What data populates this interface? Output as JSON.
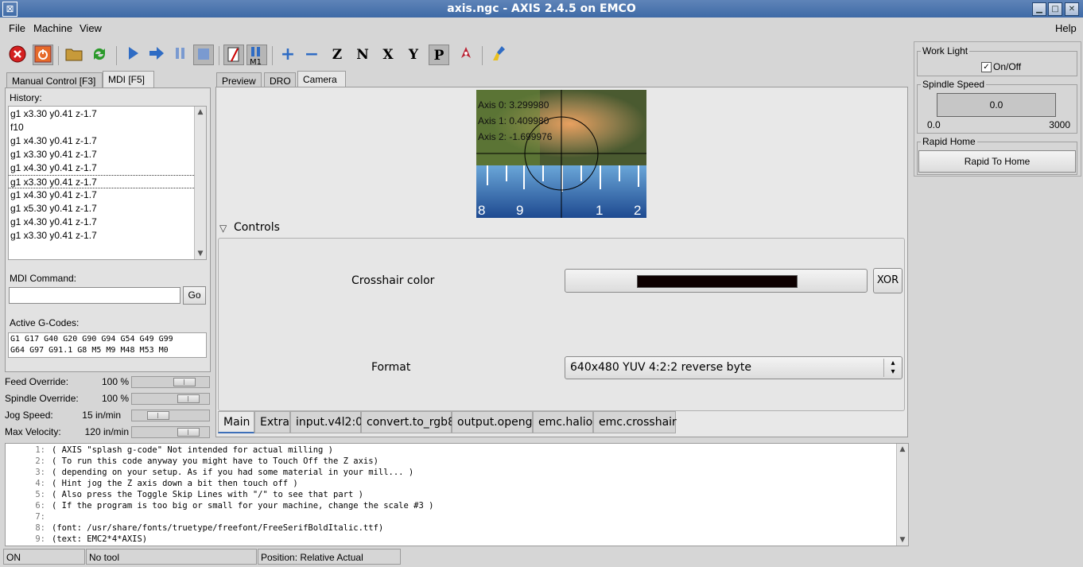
{
  "window": {
    "title": "axis.ngc - AXIS 2.4.5 on EMCO"
  },
  "menu": {
    "file": "File",
    "machine": "Machine",
    "view": "View",
    "help": "Help"
  },
  "toolbar": {
    "icons": [
      "estop-icon",
      "power-icon",
      "open-icon",
      "reload-icon",
      "run-icon",
      "step-icon",
      "pause-icon",
      "stop-icon",
      "block-delete-icon",
      "optional-stop-icon",
      "zoom-in-icon",
      "zoom-out-icon",
      "view-z-icon",
      "view-z2-icon",
      "view-x-icon",
      "view-y-icon",
      "view-p-icon",
      "rotate-icon",
      "clear-plot-icon"
    ],
    "optional_stop_label": "M1"
  },
  "left": {
    "tabs": [
      "Manual Control [F3]",
      "MDI [F5]"
    ],
    "history_label": "History:",
    "history": [
      "g1 x3.30 y0.41 z-1.7",
      "f10",
      "g1 x4.30 y0.41 z-1.7",
      "g1 x3.30 y0.41 z-1.7",
      "g1 x4.30 y0.41 z-1.7",
      "g1 x3.30 y0.41 z-1.7",
      "g1 x4.30 y0.41 z-1.7",
      "g1 x5.30 y0.41 z-1.7",
      "g1 x4.30 y0.41 z-1.7",
      "g1 x3.30 y0.41 z-1.7"
    ],
    "mdi_label": "MDI Command:",
    "mdi_value": "",
    "go_label": "Go",
    "gcodes_label": "Active G-Codes:",
    "gcodes_line1": "G1 G17 G40 G20 G90 G94 G54 G49 G99",
    "gcodes_line2": "G64 G97 G91.1 G8 M5 M9 M48 M53 M0"
  },
  "overrides": {
    "feed_label": "Feed Override:",
    "feed_value": "100 %",
    "feed_level": 0.75,
    "spindle_label": "Spindle Override:",
    "spindle_value": "100 %",
    "spindle_level": 0.82,
    "jog_label": "Jog Speed:",
    "jog_value": "15 in/min",
    "jog_level": 0.27,
    "maxvel_label": "Max Velocity:",
    "maxvel_value": "120 in/min",
    "maxvel_level": 0.82
  },
  "center": {
    "tabs": [
      "Preview",
      "DRO",
      "Camera"
    ],
    "camera_overlay": [
      "Axis 0: 3.299980",
      "Axis 1: 0.409980",
      "Axis 2: -1.699976"
    ],
    "ruler_digits": [
      "8",
      "9",
      "1",
      "2"
    ],
    "controls_label": "Controls",
    "crosshair_label": "Crosshair color",
    "crosshair_color": "#0d0000",
    "xor_label": "XOR",
    "format_label": "Format",
    "format_value": "640x480 YUV 4:2:2 reverse byte",
    "bottom_tabs": [
      "Main",
      "Extra",
      "input.v4l2:0",
      "convert.to_rgb8",
      "output.opengl",
      "emc.halio",
      "emc.crosshair"
    ]
  },
  "right": {
    "work_light_title": "Work Light",
    "work_light_check_label": "On/Off",
    "work_light_checked": true,
    "spindle_title": "Spindle Speed",
    "spindle_value": "0.0",
    "spindle_min": "0.0",
    "spindle_max": "3000",
    "rapid_title": "Rapid Home",
    "rapid_button": "Rapid To Home"
  },
  "code": {
    "lines": [
      {
        "n": "1:",
        "t": "( AXIS \"splash g-code\" Not intended for actual milling )"
      },
      {
        "n": "2:",
        "t": "( To run this code anyway you might have to Touch Off the Z axis)"
      },
      {
        "n": "3:",
        "t": "( depending on your setup. As if you had some material in your mill... )"
      },
      {
        "n": "4:",
        "t": "( Hint jog the Z axis down a bit then touch off )"
      },
      {
        "n": "5:",
        "t": "( Also press the Toggle Skip Lines with \"/\" to see that part )"
      },
      {
        "n": "6:",
        "t": "( If the program is too big or small for your machine, change the scale #3 )"
      },
      {
        "n": "7:",
        "t": ""
      },
      {
        "n": "8:",
        "t": "(font: /usr/share/fonts/truetype/freefont/FreeSerifBoldItalic.ttf)"
      },
      {
        "n": "9:",
        "t": "(text: EMC2*4*AXIS)"
      }
    ]
  },
  "status": {
    "state": "ON",
    "tool": "No tool",
    "position": "Position: Relative Actual"
  }
}
